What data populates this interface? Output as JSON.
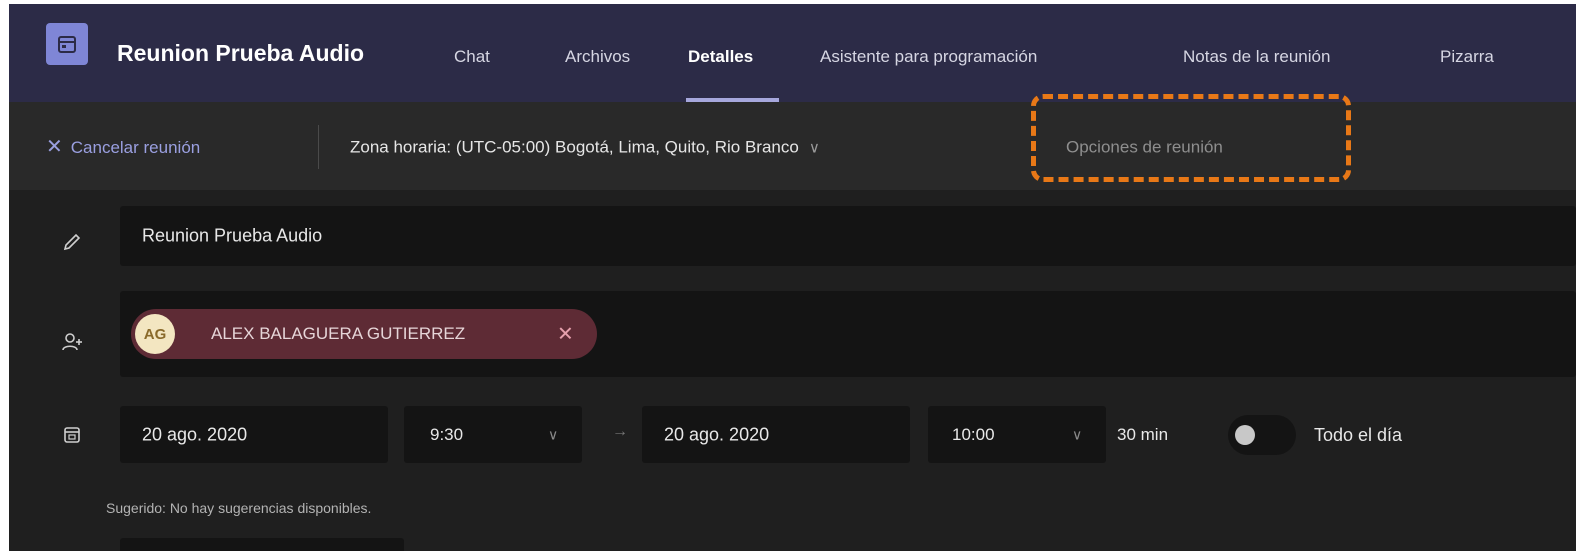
{
  "header": {
    "title": "Reunion Prueba Audio",
    "tabs": [
      {
        "label": "Chat"
      },
      {
        "label": "Archivos"
      },
      {
        "label": "Detalles"
      },
      {
        "label": "Asistente para programación"
      },
      {
        "label": "Notas de la reunión"
      },
      {
        "label": "Pizarra"
      }
    ],
    "active_tab": "Detalles"
  },
  "toolbar": {
    "cancel_label": "Cancelar reunión",
    "timezone_label": "Zona horaria: (UTC-05:00) Bogotá, Lima, Quito, Rio Branco",
    "options_label": "Opciones de reunión"
  },
  "form": {
    "title_value": "Reunion Prueba Audio",
    "attendee": {
      "initials": "AG",
      "name": "ALEX BALAGUERA GUTIERREZ"
    },
    "start_date": "20 ago. 2020",
    "start_time": "9:30",
    "arrow": "→",
    "end_date": "20 ago. 2020",
    "end_time": "10:00",
    "duration": "30 min",
    "all_day_label": "Todo el día",
    "all_day_on": false,
    "suggestion": "Sugerido: No hay sugerencias disponibles."
  },
  "colors": {
    "header_bg": "#2c2b47",
    "accent": "#7f86d6",
    "highlight": "#e87817",
    "chip_bg": "#5e2b35"
  }
}
